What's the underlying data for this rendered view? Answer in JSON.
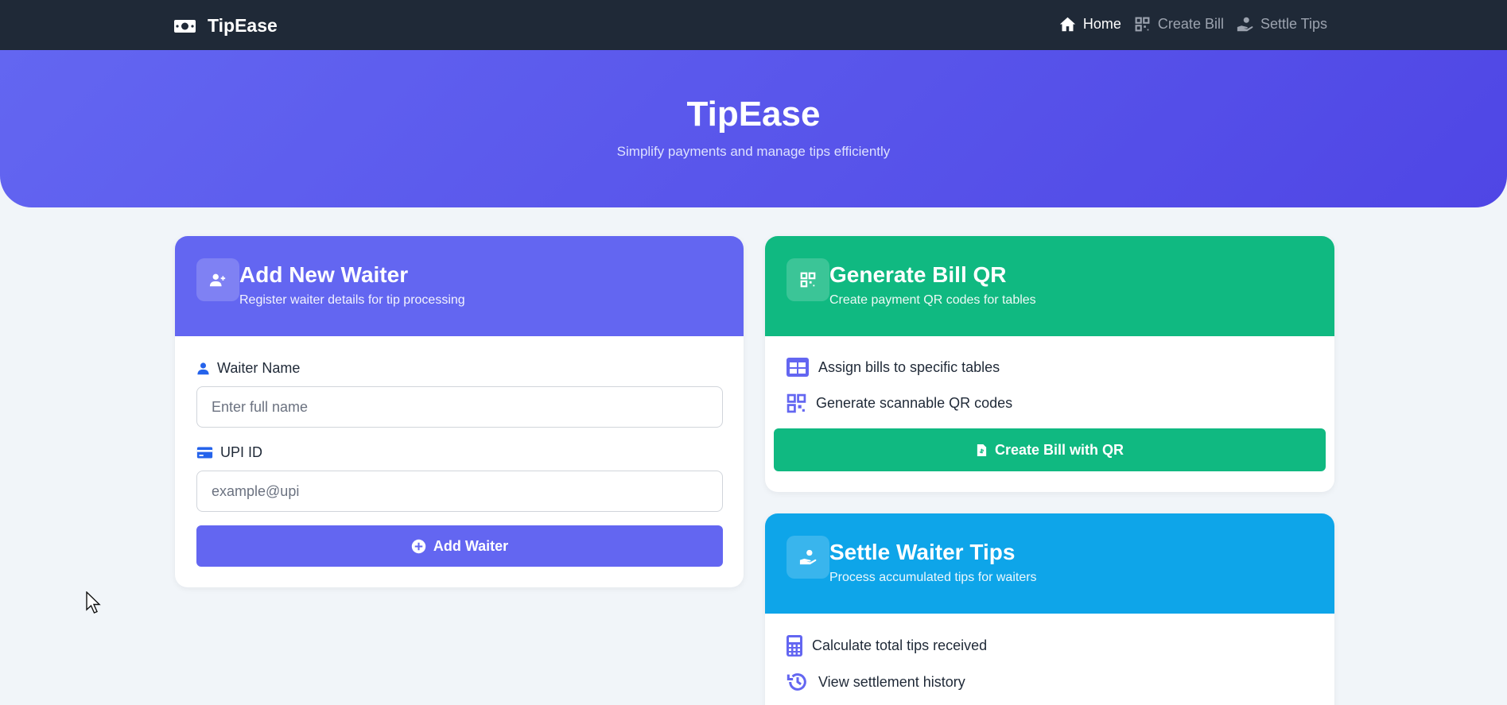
{
  "nav": {
    "brand": "TipEase",
    "links": [
      {
        "label": "Home",
        "icon": "home-icon",
        "active": true
      },
      {
        "label": "Create Bill",
        "icon": "qrcode-icon",
        "active": false
      },
      {
        "label": "Settle Tips",
        "icon": "hand-coin-icon",
        "active": false
      }
    ]
  },
  "hero": {
    "title": "TipEase",
    "subtitle": "Simplify payments and manage tips efficiently"
  },
  "add_waiter": {
    "title": "Add New Waiter",
    "subtitle": "Register waiter details for tip processing",
    "name_label": "Waiter Name",
    "name_placeholder": "Enter full name",
    "upi_label": "UPI ID",
    "upi_placeholder": "example@upi",
    "button": "Add Waiter"
  },
  "bill_qr": {
    "title": "Generate Bill QR",
    "subtitle": "Create payment QR codes for tables",
    "features": [
      "Assign bills to specific tables",
      "Generate scannable QR codes"
    ],
    "button": "Create Bill with QR"
  },
  "settle": {
    "title": "Settle Waiter Tips",
    "subtitle": "Process accumulated tips for waiters",
    "features": [
      "Calculate total tips received",
      "View settlement history"
    ]
  },
  "colors": {
    "navbar": "#1f2937",
    "indigo": "#6366f1",
    "green": "#10b981",
    "sky": "#0ea5e9",
    "background": "#f1f5f9"
  }
}
